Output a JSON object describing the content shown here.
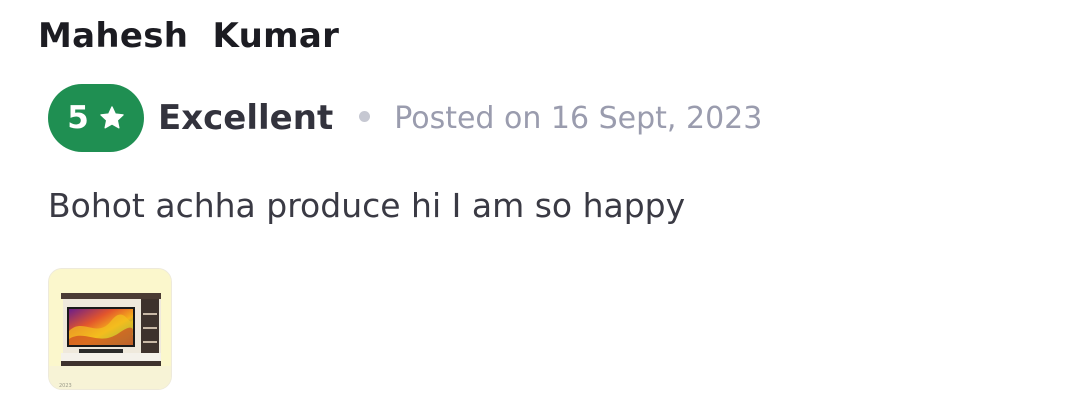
{
  "review": {
    "reviewer_name": "Mahesh  Kumar",
    "rating": {
      "value": "5",
      "max": 5,
      "label": "Excellent",
      "icon": "star-icon",
      "badge_color": "#1f8f52"
    },
    "posted_date": "Posted on 16 Sept, 2023",
    "text": "Bohot achha produce hi I am so happy",
    "photos": [
      {
        "icon": "tv-unit-photo"
      }
    ]
  }
}
